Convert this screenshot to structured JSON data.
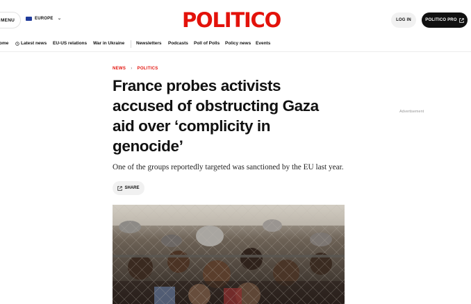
{
  "header": {
    "menu_label": "MENU",
    "edition_label": "EUROPE",
    "logo_text": "POLITICO",
    "login_label": "LOG IN",
    "pro_label": "POLITICO PRO"
  },
  "nav": {
    "items": [
      "ome",
      "Latest news",
      "EU-US relations",
      "War in Ukraine",
      "Newsletters",
      "Podcasts",
      "Poll of Polls",
      "Policy news",
      "Events"
    ]
  },
  "article": {
    "breadcrumb": [
      "NEWS",
      "POLITICS"
    ],
    "headline": "France probes activists accused of obstructing Gaza aid over ‘complicity in genocide’",
    "dek": "One of the groups reportedly targeted was sanctioned by the EU last year.",
    "share_label": "SHARE"
  },
  "sidebar": {
    "ad_label": "Advertisement"
  },
  "colors": {
    "brand_red": "#e3120b",
    "pro_button": "#111111",
    "flag_blue": "#1f3a9a"
  },
  "icons": [
    "edition-flag-icon",
    "chevron-down-icon",
    "clock-icon",
    "external-link-icon",
    "share-icon"
  ]
}
